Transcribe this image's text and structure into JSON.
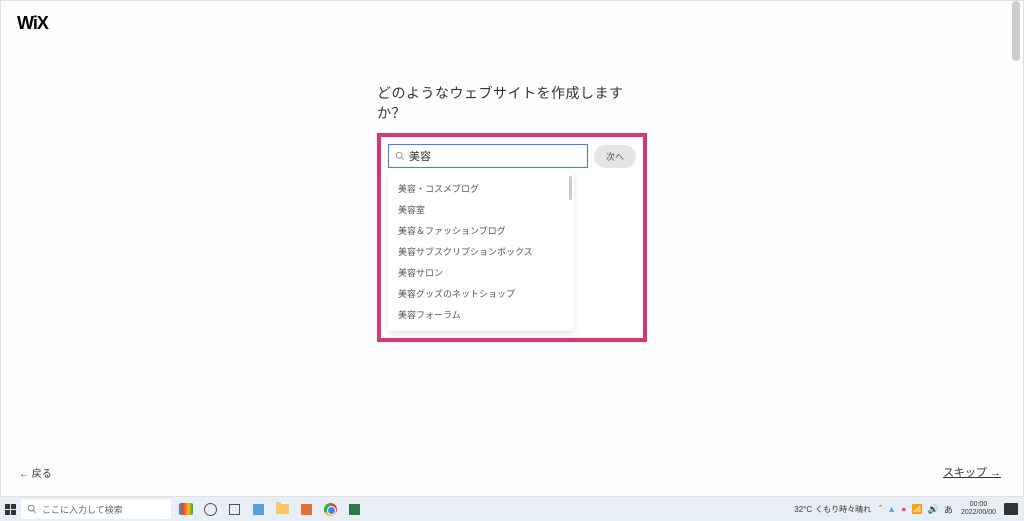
{
  "logo": "WiX",
  "headline": "どのようなウェブサイトを作成しますか？",
  "search": {
    "value": "美容"
  },
  "next_btn": "次へ",
  "suggestions": [
    "美容・コスメブログ",
    "美容室",
    "美容＆ファッションブログ",
    "美容サブスクリプションボックス",
    "美容サロン",
    "美容グッズのネットショップ",
    "美容フォーラム"
  ],
  "back_link": "← 戻る",
  "skip_link": "スキップ →",
  "taskbar": {
    "search_placeholder": "ここに入力して検索",
    "weather_temp": "32°C",
    "weather_text": "くもり時々晴れ",
    "ime": "あ",
    "time": "00:00",
    "date": "2022/00/00"
  }
}
